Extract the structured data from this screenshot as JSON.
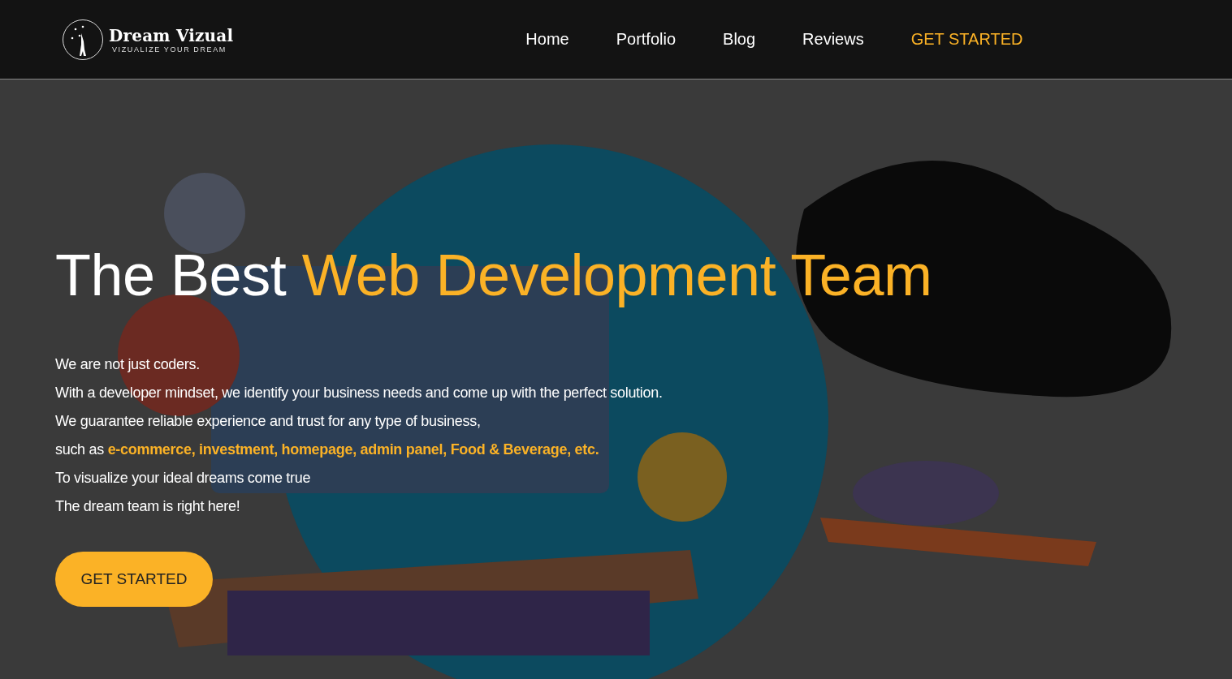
{
  "header": {
    "logo": {
      "name": "Dream Vizual",
      "tagline": "VIZUALIZE YOUR DREAM"
    },
    "nav": [
      {
        "label": "Home",
        "kind": "link"
      },
      {
        "label": "Portfolio",
        "kind": "link"
      },
      {
        "label": "Blog",
        "kind": "link"
      },
      {
        "label": "Reviews",
        "kind": "link"
      },
      {
        "label": "GET STARTED",
        "kind": "cta"
      }
    ]
  },
  "hero": {
    "headline": {
      "lead": "The Best",
      "accent": "Web Development Team"
    },
    "lines": [
      {
        "text": "We are not just coders."
      },
      {
        "text": "With a developer mindset, we identify your business needs and come up with the perfect solution."
      },
      {
        "text": "We guarantee reliable experience and trust for any type of business,"
      },
      {
        "text": "such as",
        "accent": "e-commerce, investment, homepage, admin panel, Food & Beverage, etc."
      },
      {
        "text": "To visualize your ideal dreams come true"
      },
      {
        "text": "The dream team is right here!"
      }
    ],
    "button": "GET STARTED"
  }
}
